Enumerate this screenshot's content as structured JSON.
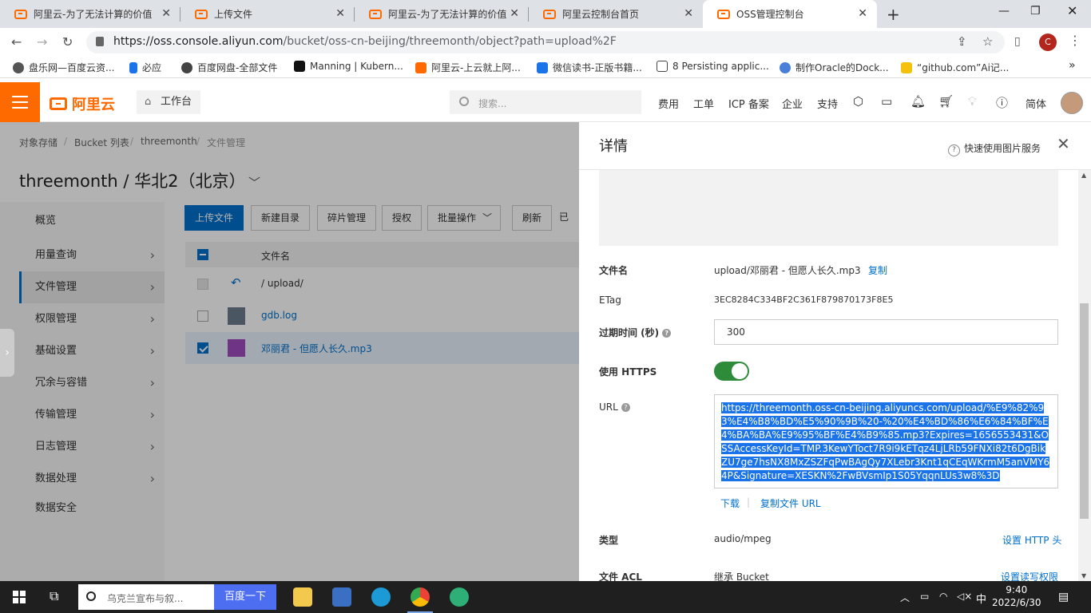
{
  "browser": {
    "tabs": [
      {
        "title": "阿里云-为了无法计算的价值"
      },
      {
        "title": "上传文件"
      },
      {
        "title": "阿里云-为了无法计算的价值"
      },
      {
        "title": "阿里云控制台首页"
      },
      {
        "title": "OSS管理控制台"
      }
    ],
    "url_host": "https://oss.console.aliyun.com",
    "url_path": "/bucket/oss-cn-beijing/threemonth/object?path=upload%2F",
    "account_initial": "C",
    "bookmarks": [
      "盘乐网—百度云资...",
      "必应",
      "百度网盘-全部文件",
      "Manning | Kubern...",
      "阿里云-上云就上阿...",
      "微信读书-正版书籍...",
      "8 Persisting applic...",
      "制作Oracle的Dock...",
      "“github.com”Ai记..."
    ]
  },
  "console_header": {
    "logo": "阿里云",
    "workbench": "工作台",
    "search_placeholder": "搜索...",
    "links": [
      "费用",
      "工单",
      "ICP 备案",
      "企业",
      "支持"
    ],
    "lang": "简体"
  },
  "breadcrumb": [
    "对象存储",
    "Bucket 列表",
    "threemonth",
    "文件管理"
  ],
  "bucket_title": "threemonth / 华北2（北京）",
  "sidebar": [
    "概览",
    "用量查询",
    "文件管理",
    "权限管理",
    "基础设置",
    "冗余与容错",
    "传输管理",
    "日志管理",
    "数据处理",
    "数据安全"
  ],
  "toolbar": {
    "upload": "上传文件",
    "new_dir": "新建目录",
    "fragments": "碎片管理",
    "authorize": "授权",
    "batch": "批量操作",
    "refresh": "刷新",
    "selected": "已选"
  },
  "file_table": {
    "header": "文件名",
    "parent": "/ upload/",
    "rows": [
      "gdb.log",
      "邓丽君 - 但愿人长久.mp3"
    ]
  },
  "drawer": {
    "title": "详情",
    "help": "快速使用图片服务",
    "filename_label": "文件名",
    "filename": "upload/邓丽君 - 但愿人长久.mp3",
    "copy": "复制",
    "etag_label": "ETag",
    "etag": "3EC8284C334BF2C361F879870173F8E5",
    "expire_label": "过期时间 (秒)",
    "expire_value": "300",
    "https_label": "使用 HTTPS",
    "url_label": "URL",
    "url": "https://threemonth.oss-cn-beijing.aliyuncs.com/upload/%E9%82%93%E4%B8%BD%E5%90%9B%20-%20%E4%BD%86%E6%84%BF%E4%BA%BA%E9%95%BF%E4%B9%85.mp3?Expires=1656553431&OSSAccessKeyId=TMP.3KewYToct7R9i9kETqz4LjLRb59FNXi82t6DgBikZU7ge7hsNX8MxZSZFqPwBAgQy7XLebr3Knt1qCEqWKrmM5anVMY64P&Signature=XESKN%2FwBVsmIp1S05YqqnLUs3w8%3D",
    "download": "下载",
    "copy_url": "复制文件 URL",
    "type_label": "类型",
    "type": "audio/mpeg",
    "set_http_header": "设置 HTTP 头",
    "acl_label": "文件 ACL",
    "acl": "继承 Bucket",
    "set_acl": "设置读写权限"
  },
  "taskbar": {
    "search_placeholder": "乌克兰宣布与叙...",
    "search_button": "百度一下",
    "ime": "中",
    "time": "9:40",
    "date": "2022/6/30"
  },
  "colors": {
    "brand": "#ff6a00",
    "primary": "#0070cc",
    "toggle_on": "#2d8b3a"
  }
}
